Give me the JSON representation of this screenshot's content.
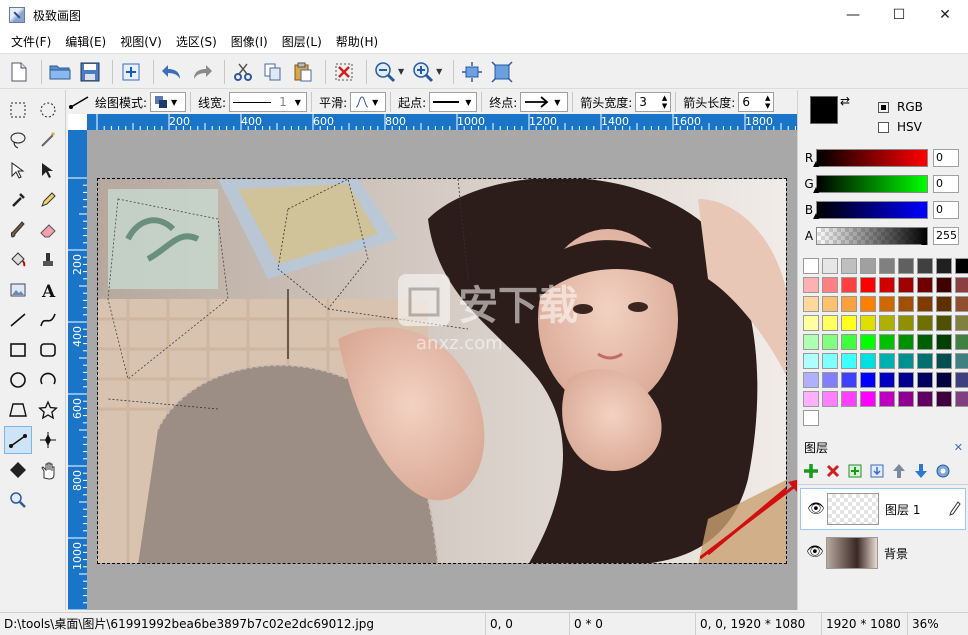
{
  "window": {
    "title": "极致画图",
    "minimize": "—",
    "maximize": "☐",
    "close": "✕"
  },
  "menu": [
    "文件(F)",
    "编辑(E)",
    "视图(V)",
    "选区(S)",
    "图像(I)",
    "图层(L)",
    "帮助(H)"
  ],
  "toolbar_icons": [
    "new-file",
    "open-folder",
    "save",
    "add-layer",
    "undo",
    "redo",
    "cut",
    "copy",
    "paste",
    "delete-selection",
    "zoom-out",
    "zoom-in",
    "fit-center",
    "fit-window"
  ],
  "left_tools": [
    "rect-select",
    "ellipse-select",
    "lasso-select",
    "magic-wand",
    "move-selection",
    "move-pixels",
    "eyedropper",
    "pencil",
    "brush",
    "eraser",
    "paint-bucket",
    "clone-stamp",
    "image",
    "text",
    "line",
    "curve",
    "rectangle",
    "rounded-rectangle",
    "ellipse",
    "arc",
    "trapezoid",
    "star",
    "polyline",
    "gradient",
    "diamond",
    "hand",
    "zoom"
  ],
  "options": {
    "draw_mode_label": "绘图模式:",
    "line_width_label": "线宽:",
    "line_width_value": "1",
    "smooth_label": "平滑:",
    "start_label": "起点:",
    "end_label": "终点:",
    "arrow_width_label": "箭头宽度:",
    "arrow_width_value": "3",
    "arrow_length_label": "箭头长度:",
    "arrow_length_value": "6"
  },
  "ruler": {
    "h_labels": [
      "200",
      "400",
      "600",
      "800",
      "1000",
      "1200",
      "1400",
      "1600",
      "1800"
    ],
    "v_labels": [
      "200",
      "400",
      "600",
      "800",
      "1000"
    ]
  },
  "color": {
    "primary": "#000000",
    "secondary": "#ffffff",
    "mode_rgb": "RGB",
    "mode_hsv": "HSV",
    "rgb_selected": true,
    "channels": [
      {
        "label": "R",
        "value": "0",
        "to": "#ff0000"
      },
      {
        "label": "G",
        "value": "0",
        "to": "#00ff00"
      },
      {
        "label": "B",
        "value": "0",
        "to": "#0000ff"
      },
      {
        "label": "A",
        "value": "255",
        "to": "#000000"
      }
    ],
    "palette": [
      [
        "#ffffff",
        "#e6e6e6",
        "#bfbfbf",
        "#a0a0a0",
        "#808080",
        "#606060",
        "#404040",
        "#202020",
        "#000000"
      ],
      [
        "#ffb0b0",
        "#ff8080",
        "#ff4040",
        "#ff0000",
        "#d00000",
        "#a00000",
        "#700000",
        "#400000",
        "#8a4040"
      ],
      [
        "#ffd8a0",
        "#ffc070",
        "#ffa040",
        "#ff8000",
        "#d06800",
        "#a05000",
        "#803c00",
        "#603000",
        "#905030"
      ],
      [
        "#ffffa0",
        "#ffff60",
        "#ffff20",
        "#e0e000",
        "#b0b000",
        "#909000",
        "#707000",
        "#505000",
        "#808040"
      ],
      [
        "#b0ffb0",
        "#80ff80",
        "#40ff40",
        "#00ff00",
        "#00c000",
        "#009000",
        "#006000",
        "#004000",
        "#408040"
      ],
      [
        "#b0ffff",
        "#80ffff",
        "#40ffff",
        "#00e0e0",
        "#00b0b0",
        "#009090",
        "#007070",
        "#005050",
        "#408080"
      ],
      [
        "#b0b0ff",
        "#8080ff",
        "#4040ff",
        "#0000ff",
        "#0000c0",
        "#000090",
        "#000060",
        "#000040",
        "#404080"
      ],
      [
        "#ffb0ff",
        "#ff80ff",
        "#ff40ff",
        "#ff00ff",
        "#c000c0",
        "#900090",
        "#600060",
        "#400040",
        "#804080"
      ],
      [
        "#ffffff"
      ]
    ]
  },
  "layers_panel": {
    "title": "图层",
    "close": "✕",
    "layers": [
      {
        "name": "图层 1",
        "selected": true
      },
      {
        "name": "背景",
        "selected": false
      }
    ]
  },
  "status": {
    "path": "D:\\tools\\桌面\\图片\\61991992bea6be3897b7c02e2dc69012.jpg",
    "cursor": "0, 0",
    "selection_size": "0 * 0",
    "selection_rect": "0, 0, 1920 * 1080",
    "image_size": "1920 * 1080",
    "zoom": "36%"
  },
  "watermark": {
    "text": "安下载",
    "sub": "anxz.com"
  }
}
